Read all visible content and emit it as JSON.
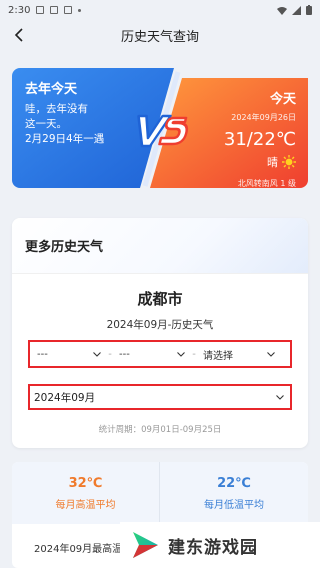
{
  "status_bar": {
    "time": "2:30"
  },
  "header": {
    "title": "历史天气查询"
  },
  "vs_card": {
    "last_year": {
      "title": "去年今天",
      "lines": [
        "哇，去年没有",
        "这一天。",
        "2月29日4年一遇"
      ]
    },
    "today": {
      "title": "今天",
      "date": "2024年09月26日",
      "temp": "31/22℃",
      "condition": "晴",
      "wind": "北风转南风 1 级"
    }
  },
  "more_history": {
    "title": "更多历史天气",
    "city": "成都市",
    "subtitle": "2024年09月-历史天气",
    "selects": [
      {
        "value": "---"
      },
      {
        "value": "---"
      },
      {
        "value": "请选择"
      }
    ],
    "separator": "-",
    "month_select": {
      "value": "2024年09月"
    },
    "period": "统计周期：09月01日-09月25日"
  },
  "stats": {
    "high_avg": {
      "value": "32℃",
      "label": "每月高温平均"
    },
    "low_avg": {
      "value": "22℃",
      "label": "每月低温平均"
    },
    "row_text": "2024年09月最高温"
  },
  "watermark": {
    "text": "建东游戏园"
  },
  "colors": {
    "blue": "#2f7de8",
    "orange": "#f4742f",
    "highlight_red": "#e8262b",
    "hot": "#f07a2b",
    "cold": "#3a7fd5"
  }
}
